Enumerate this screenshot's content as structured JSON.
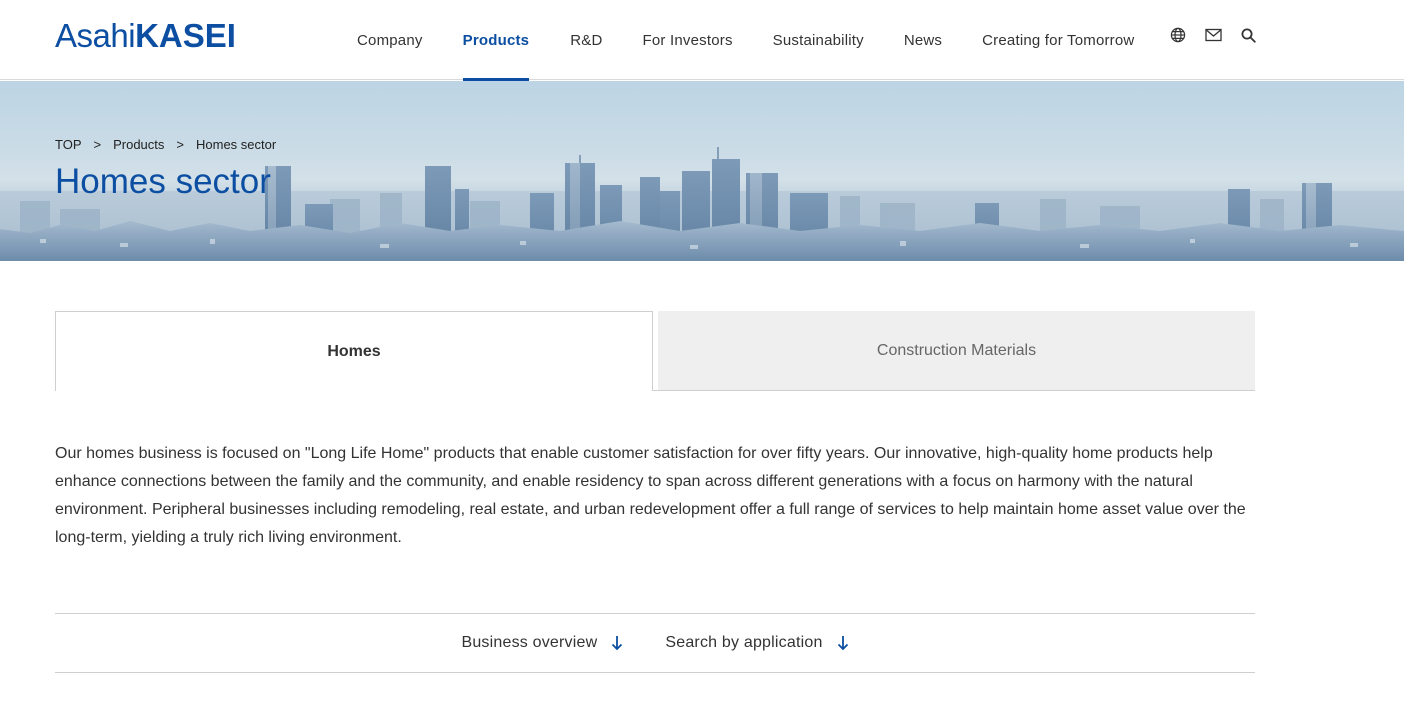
{
  "header": {
    "logo": {
      "part1": "Asahi",
      "part2": "KASEI"
    },
    "nav": [
      {
        "label": "Company",
        "active": false
      },
      {
        "label": "Products",
        "active": true
      },
      {
        "label": "R&D",
        "active": false
      },
      {
        "label": "For Investors",
        "active": false
      },
      {
        "label": "Sustainability",
        "active": false
      },
      {
        "label": "News",
        "active": false
      },
      {
        "label": "Creating for Tomorrow",
        "active": false
      }
    ],
    "icons": [
      "globe-icon",
      "mail-icon",
      "search-icon"
    ]
  },
  "hero": {
    "breadcrumb": {
      "top": "TOP",
      "sep": ">",
      "products": "Products",
      "current": "Homes sector"
    },
    "title": "Homes sector"
  },
  "tabs": {
    "homes": "Homes",
    "construction": "Construction Materials"
  },
  "intro": {
    "text": "Our homes business is focused on \"Long Life Home\" products that enable customer satisfaction for over fifty years. Our innovative, high-quality home products help enhance connections between the family and the community, and enable residency to span across different generations with a focus on harmony with the natural environment. Peripheral businesses including remodeling, real estate, and urban redevelopment offer a full range of services to help maintain home asset value over the long-term, yielding a truly rich living environment."
  },
  "anchors": {
    "business_overview": "Business overview",
    "search_by_application": "Search by application"
  },
  "colors": {
    "brand": "#0b4ea2",
    "text": "#333333",
    "tab_inactive_bg": "#efefef",
    "border": "#cfcfcf"
  }
}
